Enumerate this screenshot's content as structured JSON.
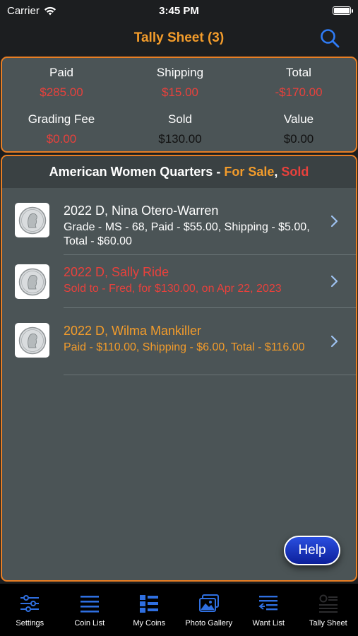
{
  "status_bar": {
    "carrier": "Carrier",
    "time": "3:45 PM"
  },
  "nav": {
    "title": "Tally Sheet (3)"
  },
  "summary": {
    "paid": {
      "label": "Paid",
      "value": "$285.00"
    },
    "shipping": {
      "label": "Shipping",
      "value": "$15.00"
    },
    "total": {
      "label": "Total",
      "value": "-$170.00"
    },
    "grading_fee": {
      "label": "Grading Fee",
      "value": "$0.00"
    },
    "sold": {
      "label": "Sold",
      "value": "$130.00"
    },
    "value": {
      "label": "Value",
      "value": "$0.00"
    }
  },
  "section": {
    "title": "American Women Quarters - ",
    "for_sale": "For Sale",
    "comma": ", ",
    "sold": "Sold"
  },
  "items": [
    {
      "title": "2022 D, Nina Otero-Warren",
      "subtitle": "Grade - MS - 68, Paid - $55.00, Shipping - $5.00, Total - $60.00",
      "color": "#ffffff"
    },
    {
      "title": "2022 D, Sally Ride",
      "subtitle": "Sold to - Fred, for $130.00, on Apr 22, 2023",
      "color": "#e8413c"
    },
    {
      "title": "2022 D, Wilma Mankiller",
      "subtitle": "Paid - $110.00, Shipping - $6.00, Total - $116.00",
      "color": "#f39c2b"
    }
  ],
  "help_label": "Help",
  "tabs": [
    {
      "label": "Settings",
      "icon": "sliders-icon"
    },
    {
      "label": "Coin List",
      "icon": "list-icon"
    },
    {
      "label": "My Coins",
      "icon": "grid-list-icon"
    },
    {
      "label": "Photo Gallery",
      "icon": "photos-icon"
    },
    {
      "label": "Want List",
      "icon": "transfer-list-icon"
    },
    {
      "label": "Tally Sheet",
      "icon": "tally-icon"
    }
  ],
  "colors": {
    "accent": "#f39c2b",
    "border": "#e87e24",
    "negative": "#e8413c",
    "tab_icon": "#2f6fe0"
  }
}
